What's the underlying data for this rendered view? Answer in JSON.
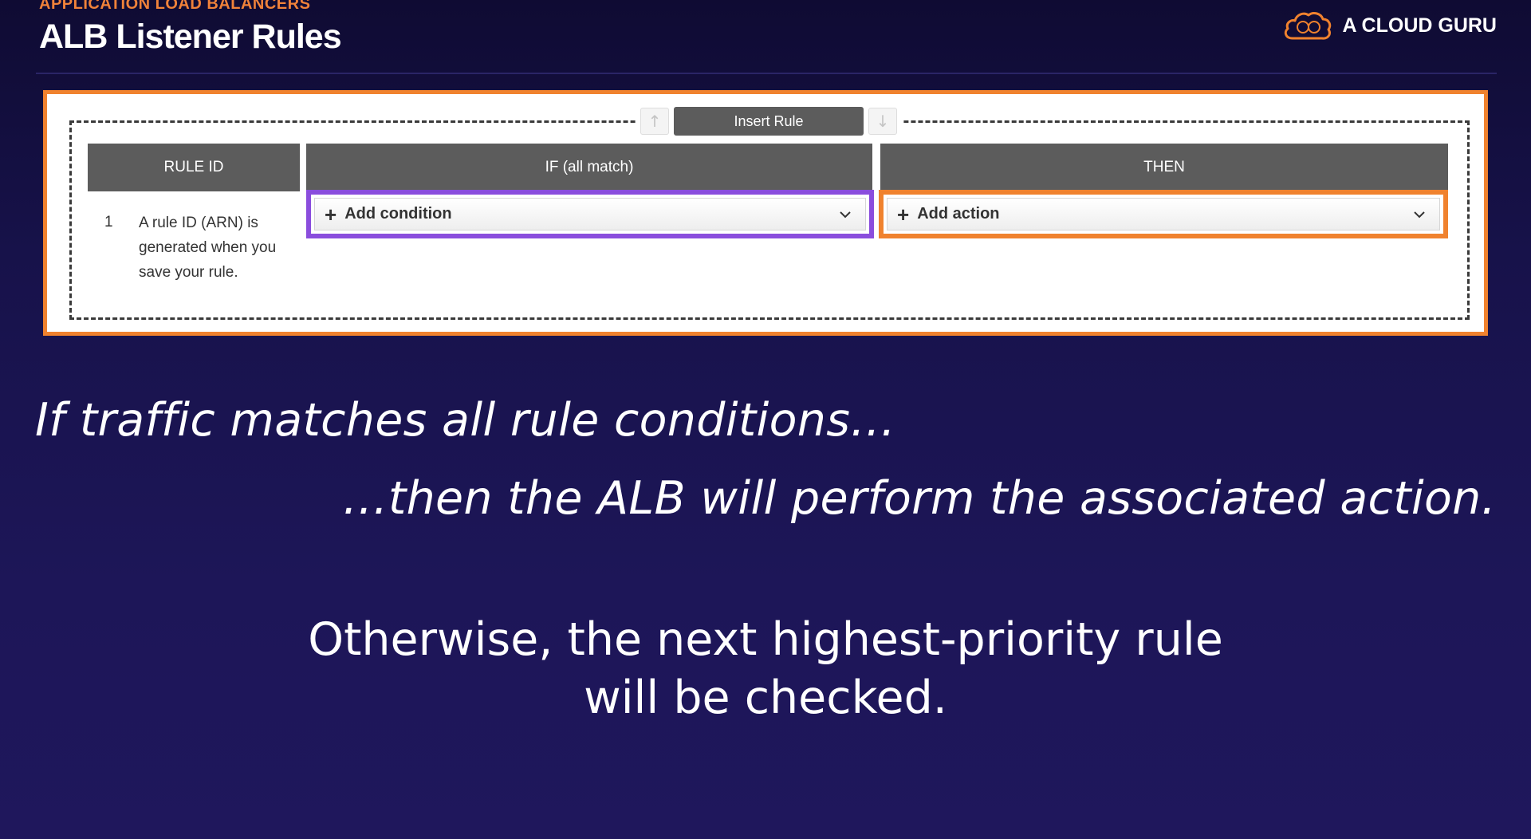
{
  "header": {
    "eyebrow": "APPLICATION LOAD BALANCERS",
    "title": "ALB Listener Rules",
    "brand": "A CLOUD GURU"
  },
  "rule_editor": {
    "insert_rule_label": "Insert Rule",
    "move_up_glyph": "↑",
    "move_down_glyph": "↓",
    "columns": {
      "rule_id": "RULE ID",
      "if": "IF (all match)",
      "then": "THEN"
    },
    "rule": {
      "number": "1",
      "id_note": "A rule ID (ARN) is generated when you save your rule."
    },
    "condition_select": {
      "label": "Add condition",
      "icon": "plus-icon"
    },
    "action_select": {
      "label": "Add action",
      "icon": "plus-icon"
    }
  },
  "narration": {
    "line1": "If traffic matches all rule conditions…",
    "line2": "…then the ALB will perform the associated action.",
    "line3a": "Otherwise, the next highest-priority rule",
    "line3b": "will be checked."
  },
  "colors": {
    "accent_orange": "#f0822e",
    "highlight_purple": "#8a4ddd",
    "background": "#1d1658"
  }
}
